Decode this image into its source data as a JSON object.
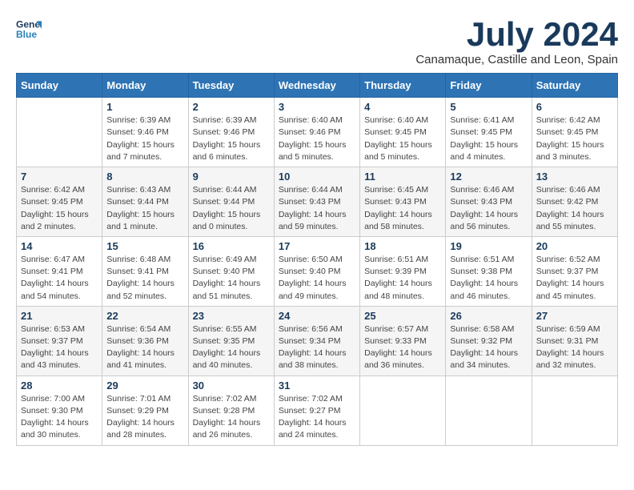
{
  "header": {
    "logo_line1": "General",
    "logo_line2": "Blue",
    "month_year": "July 2024",
    "location": "Canamaque, Castille and Leon, Spain"
  },
  "weekdays": [
    "Sunday",
    "Monday",
    "Tuesday",
    "Wednesday",
    "Thursday",
    "Friday",
    "Saturday"
  ],
  "weeks": [
    [
      {
        "day": "",
        "detail": ""
      },
      {
        "day": "1",
        "detail": "Sunrise: 6:39 AM\nSunset: 9:46 PM\nDaylight: 15 hours\nand 7 minutes."
      },
      {
        "day": "2",
        "detail": "Sunrise: 6:39 AM\nSunset: 9:46 PM\nDaylight: 15 hours\nand 6 minutes."
      },
      {
        "day": "3",
        "detail": "Sunrise: 6:40 AM\nSunset: 9:46 PM\nDaylight: 15 hours\nand 5 minutes."
      },
      {
        "day": "4",
        "detail": "Sunrise: 6:40 AM\nSunset: 9:45 PM\nDaylight: 15 hours\nand 5 minutes."
      },
      {
        "day": "5",
        "detail": "Sunrise: 6:41 AM\nSunset: 9:45 PM\nDaylight: 15 hours\nand 4 minutes."
      },
      {
        "day": "6",
        "detail": "Sunrise: 6:42 AM\nSunset: 9:45 PM\nDaylight: 15 hours\nand 3 minutes."
      }
    ],
    [
      {
        "day": "7",
        "detail": "Sunrise: 6:42 AM\nSunset: 9:45 PM\nDaylight: 15 hours\nand 2 minutes."
      },
      {
        "day": "8",
        "detail": "Sunrise: 6:43 AM\nSunset: 9:44 PM\nDaylight: 15 hours\nand 1 minute."
      },
      {
        "day": "9",
        "detail": "Sunrise: 6:44 AM\nSunset: 9:44 PM\nDaylight: 15 hours\nand 0 minutes."
      },
      {
        "day": "10",
        "detail": "Sunrise: 6:44 AM\nSunset: 9:43 PM\nDaylight: 14 hours\nand 59 minutes."
      },
      {
        "day": "11",
        "detail": "Sunrise: 6:45 AM\nSunset: 9:43 PM\nDaylight: 14 hours\nand 58 minutes."
      },
      {
        "day": "12",
        "detail": "Sunrise: 6:46 AM\nSunset: 9:43 PM\nDaylight: 14 hours\nand 56 minutes."
      },
      {
        "day": "13",
        "detail": "Sunrise: 6:46 AM\nSunset: 9:42 PM\nDaylight: 14 hours\nand 55 minutes."
      }
    ],
    [
      {
        "day": "14",
        "detail": "Sunrise: 6:47 AM\nSunset: 9:41 PM\nDaylight: 14 hours\nand 54 minutes."
      },
      {
        "day": "15",
        "detail": "Sunrise: 6:48 AM\nSunset: 9:41 PM\nDaylight: 14 hours\nand 52 minutes."
      },
      {
        "day": "16",
        "detail": "Sunrise: 6:49 AM\nSunset: 9:40 PM\nDaylight: 14 hours\nand 51 minutes."
      },
      {
        "day": "17",
        "detail": "Sunrise: 6:50 AM\nSunset: 9:40 PM\nDaylight: 14 hours\nand 49 minutes."
      },
      {
        "day": "18",
        "detail": "Sunrise: 6:51 AM\nSunset: 9:39 PM\nDaylight: 14 hours\nand 48 minutes."
      },
      {
        "day": "19",
        "detail": "Sunrise: 6:51 AM\nSunset: 9:38 PM\nDaylight: 14 hours\nand 46 minutes."
      },
      {
        "day": "20",
        "detail": "Sunrise: 6:52 AM\nSunset: 9:37 PM\nDaylight: 14 hours\nand 45 minutes."
      }
    ],
    [
      {
        "day": "21",
        "detail": "Sunrise: 6:53 AM\nSunset: 9:37 PM\nDaylight: 14 hours\nand 43 minutes."
      },
      {
        "day": "22",
        "detail": "Sunrise: 6:54 AM\nSunset: 9:36 PM\nDaylight: 14 hours\nand 41 minutes."
      },
      {
        "day": "23",
        "detail": "Sunrise: 6:55 AM\nSunset: 9:35 PM\nDaylight: 14 hours\nand 40 minutes."
      },
      {
        "day": "24",
        "detail": "Sunrise: 6:56 AM\nSunset: 9:34 PM\nDaylight: 14 hours\nand 38 minutes."
      },
      {
        "day": "25",
        "detail": "Sunrise: 6:57 AM\nSunset: 9:33 PM\nDaylight: 14 hours\nand 36 minutes."
      },
      {
        "day": "26",
        "detail": "Sunrise: 6:58 AM\nSunset: 9:32 PM\nDaylight: 14 hours\nand 34 minutes."
      },
      {
        "day": "27",
        "detail": "Sunrise: 6:59 AM\nSunset: 9:31 PM\nDaylight: 14 hours\nand 32 minutes."
      }
    ],
    [
      {
        "day": "28",
        "detail": "Sunrise: 7:00 AM\nSunset: 9:30 PM\nDaylight: 14 hours\nand 30 minutes."
      },
      {
        "day": "29",
        "detail": "Sunrise: 7:01 AM\nSunset: 9:29 PM\nDaylight: 14 hours\nand 28 minutes."
      },
      {
        "day": "30",
        "detail": "Sunrise: 7:02 AM\nSunset: 9:28 PM\nDaylight: 14 hours\nand 26 minutes."
      },
      {
        "day": "31",
        "detail": "Sunrise: 7:02 AM\nSunset: 9:27 PM\nDaylight: 14 hours\nand 24 minutes."
      },
      {
        "day": "",
        "detail": ""
      },
      {
        "day": "",
        "detail": ""
      },
      {
        "day": "",
        "detail": ""
      }
    ]
  ]
}
